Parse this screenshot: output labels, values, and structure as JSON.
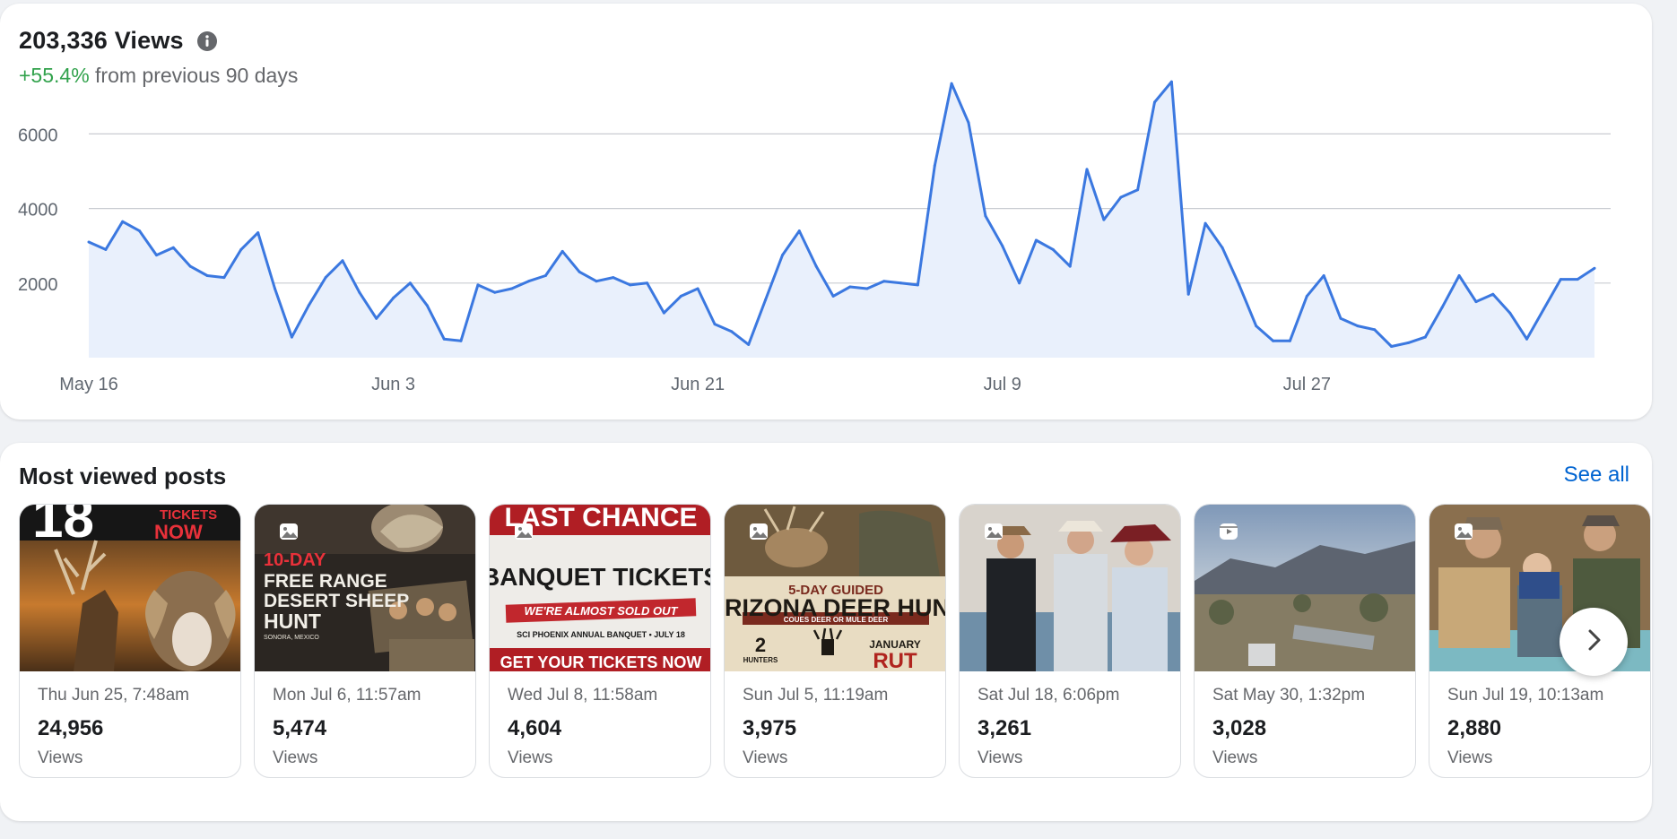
{
  "views": {
    "total_label": "203,336 Views",
    "change_pct": "+55.4%",
    "change_text": " from previous 90 days",
    "colors": {
      "line": "#3b78e0",
      "fill": "#e9f0fc",
      "positive": "#31a24c",
      "grid": "#c9ccd1"
    }
  },
  "chart_data": {
    "type": "area",
    "ylim": [
      0,
      7500
    ],
    "yticks": [
      2000,
      4000,
      6000
    ],
    "ytick_labels": [
      "2000",
      "4000",
      "6000"
    ],
    "x_tick_indices": [
      0,
      18,
      36,
      54,
      72
    ],
    "x_tick_labels": [
      "May 16",
      "Jun 3",
      "Jun 21",
      "Jul 9",
      "Jul 27"
    ],
    "grid": true,
    "values": [
      3100,
      2900,
      3650,
      3400,
      2750,
      2950,
      2450,
      2200,
      2150,
      2900,
      3350,
      1850,
      550,
      1400,
      2150,
      2600,
      1750,
      1050,
      1600,
      2000,
      1400,
      500,
      450,
      1950,
      1750,
      1850,
      2050,
      2200,
      2850,
      2300,
      2050,
      2150,
      1950,
      2000,
      1200,
      1650,
      1850,
      900,
      700,
      350,
      1550,
      2750,
      3400,
      2450,
      1650,
      1900,
      1850,
      2050,
      2000,
      1950,
      5150,
      7350,
      6300,
      3800,
      3000,
      2000,
      3150,
      2900,
      2450,
      5050,
      3700,
      4300,
      4500,
      6850,
      7400,
      1700,
      3600,
      2950,
      1950,
      850,
      450,
      450,
      1650,
      2200,
      1050,
      850,
      750,
      300,
      400,
      550,
      1350,
      2200,
      1500,
      1700,
      1200,
      500,
      1300,
      2100,
      2100,
      2400
    ]
  },
  "posts": {
    "heading": "Most viewed posts",
    "see_all": "See all",
    "items": [
      {
        "date": "Thu Jun 25, 7:48am",
        "views": "24,956",
        "label": "Views",
        "thumb_text": [
          "18",
          "TICKETS",
          "NOW"
        ]
      },
      {
        "date": "Mon Jul 6, 11:57am",
        "views": "5,474",
        "label": "Views",
        "thumb_text": [
          "10-DAY",
          "FREE RANGE",
          "DESERT SHEEP",
          "HUNT",
          "SONORA, MEXICO"
        ]
      },
      {
        "date": "Wed Jul 8, 11:58am",
        "views": "4,604",
        "label": "Views",
        "thumb_text": [
          "LAST CHANCE",
          "BANQUET TICKETS",
          "WE'RE ALMOST SOLD OUT",
          "SCI PHOENIX ANNUAL BANQUET • JULY 18",
          "GET YOUR TICKETS NOW"
        ]
      },
      {
        "date": "Sun Jul 5, 11:19am",
        "views": "3,975",
        "label": "Views",
        "thumb_text": [
          "5-DAY GUIDED",
          "ARIZONA DEER HUNT",
          "COUES DEER OR MULE DEER",
          "2",
          "HUNTERS",
          "JANUARY",
          "RUT"
        ]
      },
      {
        "date": "Sat Jul 18, 6:06pm",
        "views": "3,261",
        "label": "Views",
        "thumb_text": []
      },
      {
        "date": "Sat May 30, 1:32pm",
        "views": "3,028",
        "label": "Views",
        "thumb_text": []
      },
      {
        "date": "Sun Jul 19, 10:13am",
        "views": "2,880",
        "label": "Views",
        "thumb_text": []
      }
    ]
  },
  "icons": {
    "info": "info-icon",
    "photo_badge": "photo-icon",
    "reel_badge": "reel-icon",
    "next": "chevron-right-icon"
  }
}
